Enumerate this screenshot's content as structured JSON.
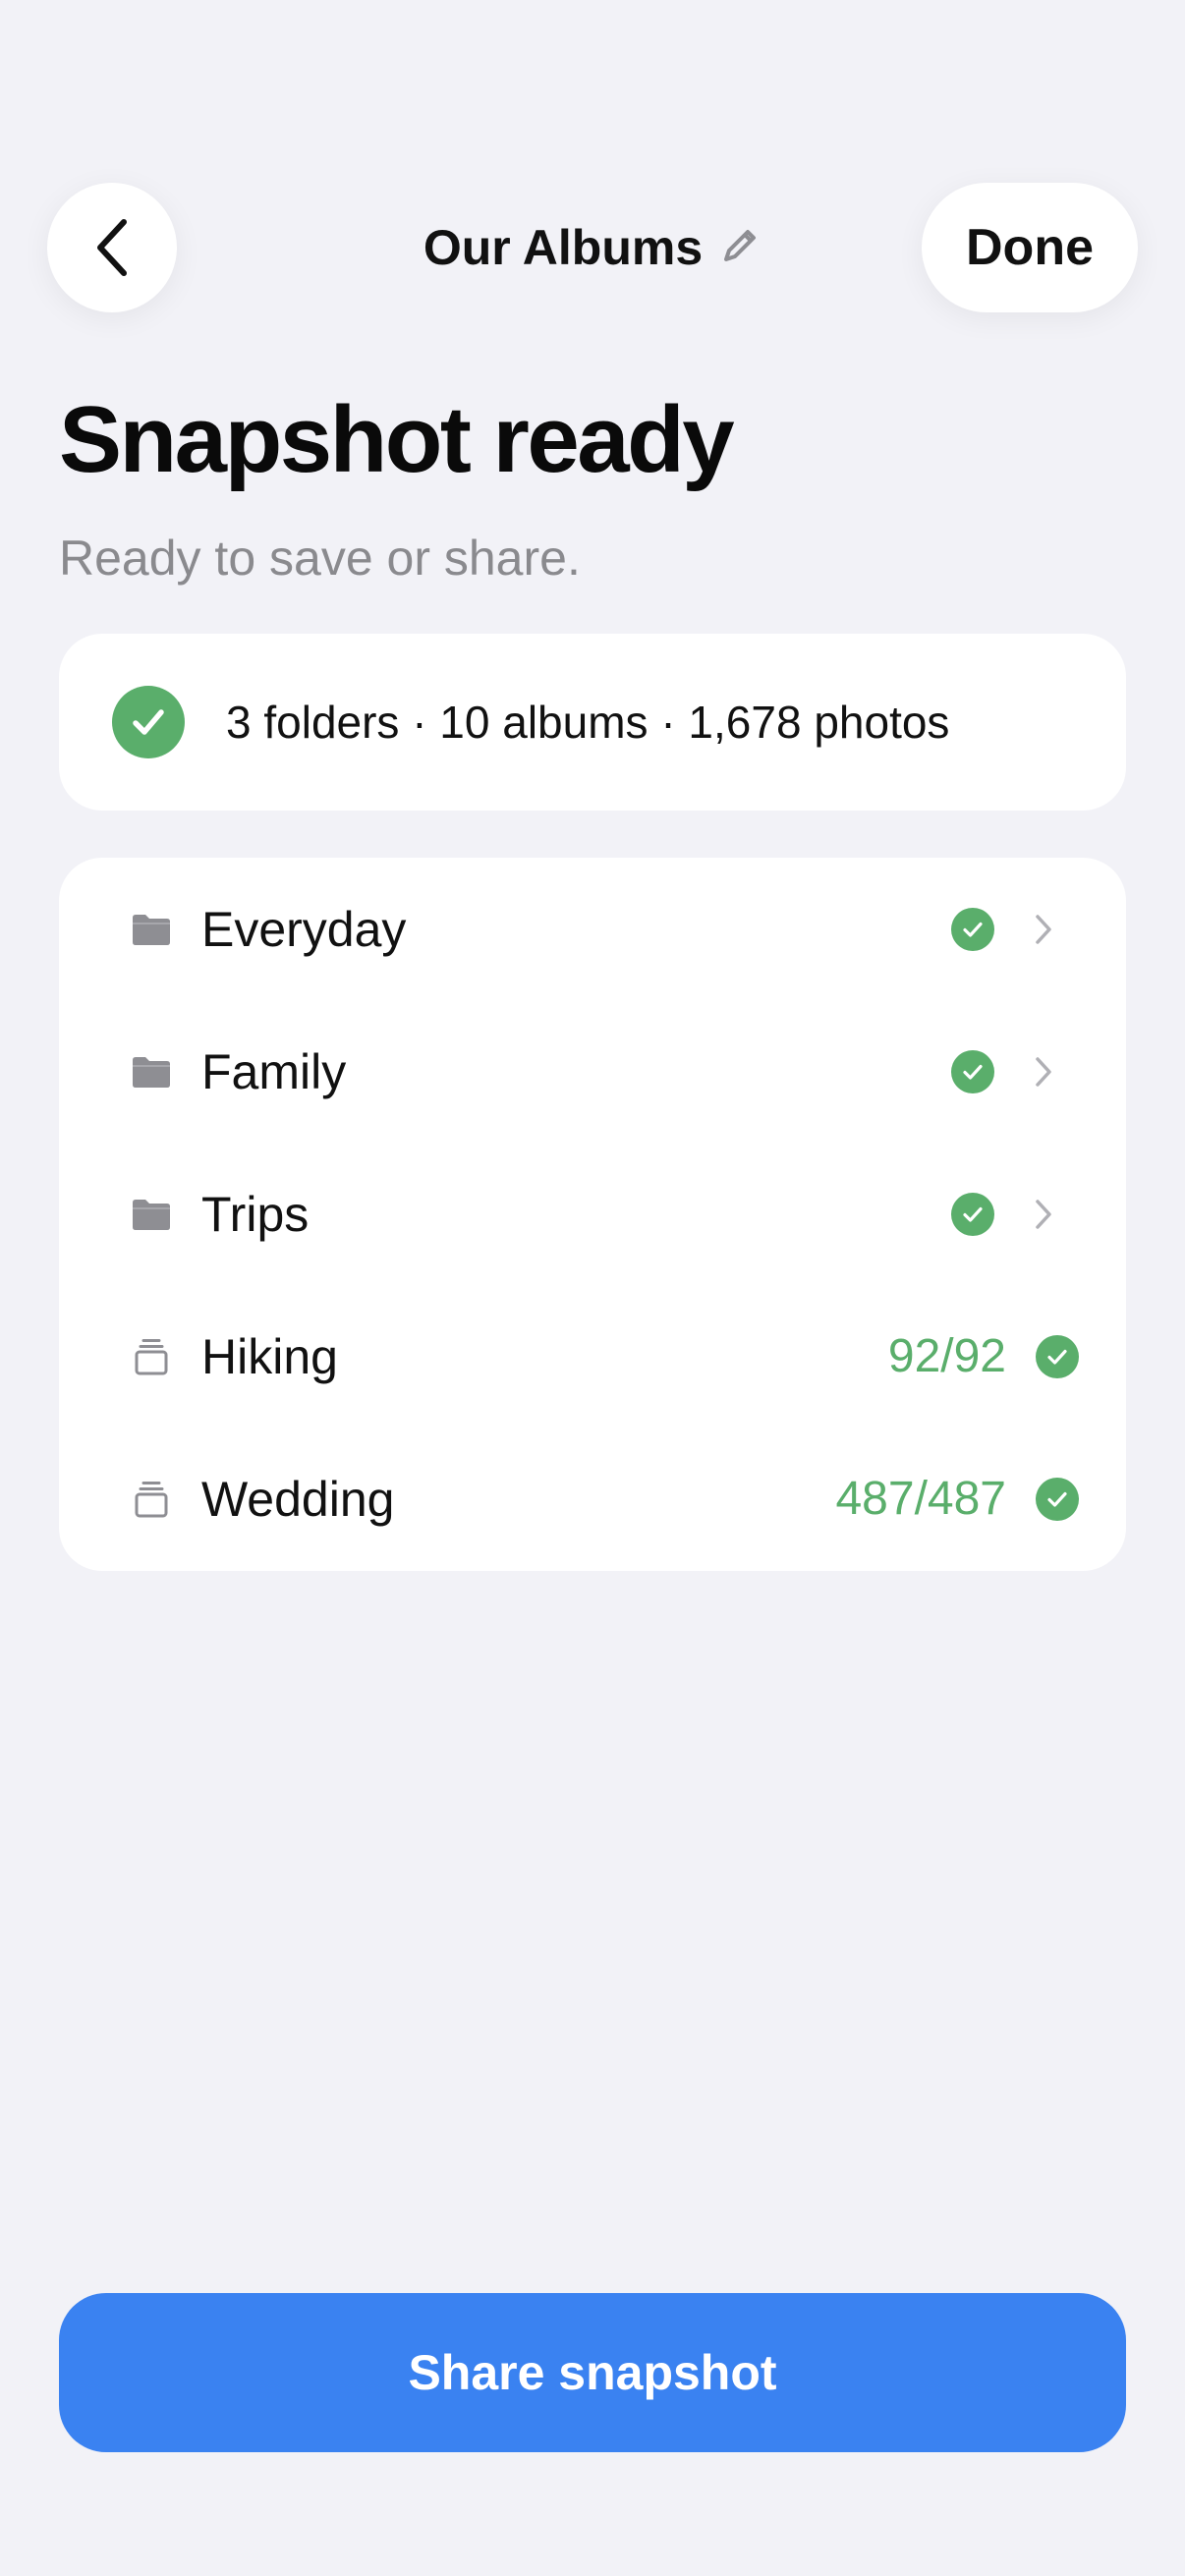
{
  "header": {
    "title": "Our Albums",
    "done_label": "Done",
    "back_icon": "chevron-left-icon",
    "edit_icon": "pencil-icon"
  },
  "page": {
    "title": "Snapshot ready",
    "subtitle": "Ready to save or share."
  },
  "summary": {
    "text": "3 folders · 10 albums · 1,678 photos",
    "icon": "checkmark-circle-icon"
  },
  "items": [
    {
      "type": "folder",
      "label": "Everyday",
      "status": "done"
    },
    {
      "type": "folder",
      "label": "Family",
      "status": "done"
    },
    {
      "type": "folder",
      "label": "Trips",
      "status": "done"
    },
    {
      "type": "album",
      "label": "Hiking",
      "count": "92/92",
      "status": "done"
    },
    {
      "type": "album",
      "label": "Wedding",
      "count": "487/487",
      "status": "done"
    }
  ],
  "footer": {
    "share_label": "Share snapshot"
  },
  "colors": {
    "background": "#F2F2F7",
    "card": "#FFFFFF",
    "success_green": "#5AAE6B",
    "primary_blue": "#3A82F1",
    "secondary_text": "#8A8A8E",
    "folder_icon": "#8E8E93"
  }
}
